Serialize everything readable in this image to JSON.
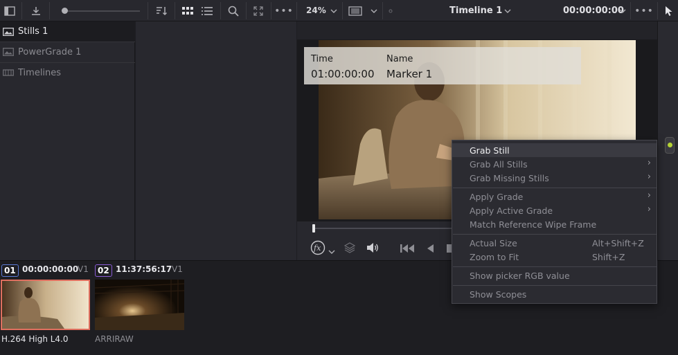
{
  "toolbar": {
    "zoom": "24%",
    "timeline_title": "Timeline 1",
    "timecode": "00:00:00:00"
  },
  "sidebar": {
    "items": [
      {
        "label": "Stills 1"
      },
      {
        "label": "PowerGrade 1"
      },
      {
        "label": "Timelines"
      }
    ]
  },
  "marker_overlay": {
    "time_label": "Time",
    "time_value": "01:00:00:00",
    "name_label": "Name",
    "name_value": "Marker 1"
  },
  "context_menu": {
    "items": [
      {
        "label": "Grab Still",
        "shortcut": "",
        "submenu": false
      },
      {
        "label": "Grab All Stills",
        "shortcut": "",
        "submenu": true
      },
      {
        "label": "Grab Missing Stills",
        "shortcut": "",
        "submenu": true
      },
      {
        "label": "Apply Grade",
        "shortcut": "",
        "submenu": true
      },
      {
        "label": "Apply Active Grade",
        "shortcut": "",
        "submenu": true
      },
      {
        "label": "Match Reference Wipe Frame",
        "shortcut": "",
        "submenu": false
      },
      {
        "label": "Actual Size",
        "shortcut": "Alt+Shift+Z",
        "submenu": false
      },
      {
        "label": "Zoom to Fit",
        "shortcut": "Shift+Z",
        "submenu": false
      },
      {
        "label": "Show picker RGB value",
        "shortcut": "",
        "submenu": false
      },
      {
        "label": "Show Scopes",
        "shortcut": "",
        "submenu": false
      }
    ]
  },
  "clips": [
    {
      "number": "01",
      "timecode": "00:00:00:00",
      "track": "V1",
      "codec": "H.264 High L4.0",
      "number_color": "#5b7bd6"
    },
    {
      "number": "02",
      "timecode": "11:37:56:17",
      "track": "V1",
      "codec": "ARRIRAW",
      "number_color": "#8a5bd6"
    }
  ],
  "colors": {
    "accent_selected_clip": "#e07060",
    "knob_green": "#b5d336"
  }
}
